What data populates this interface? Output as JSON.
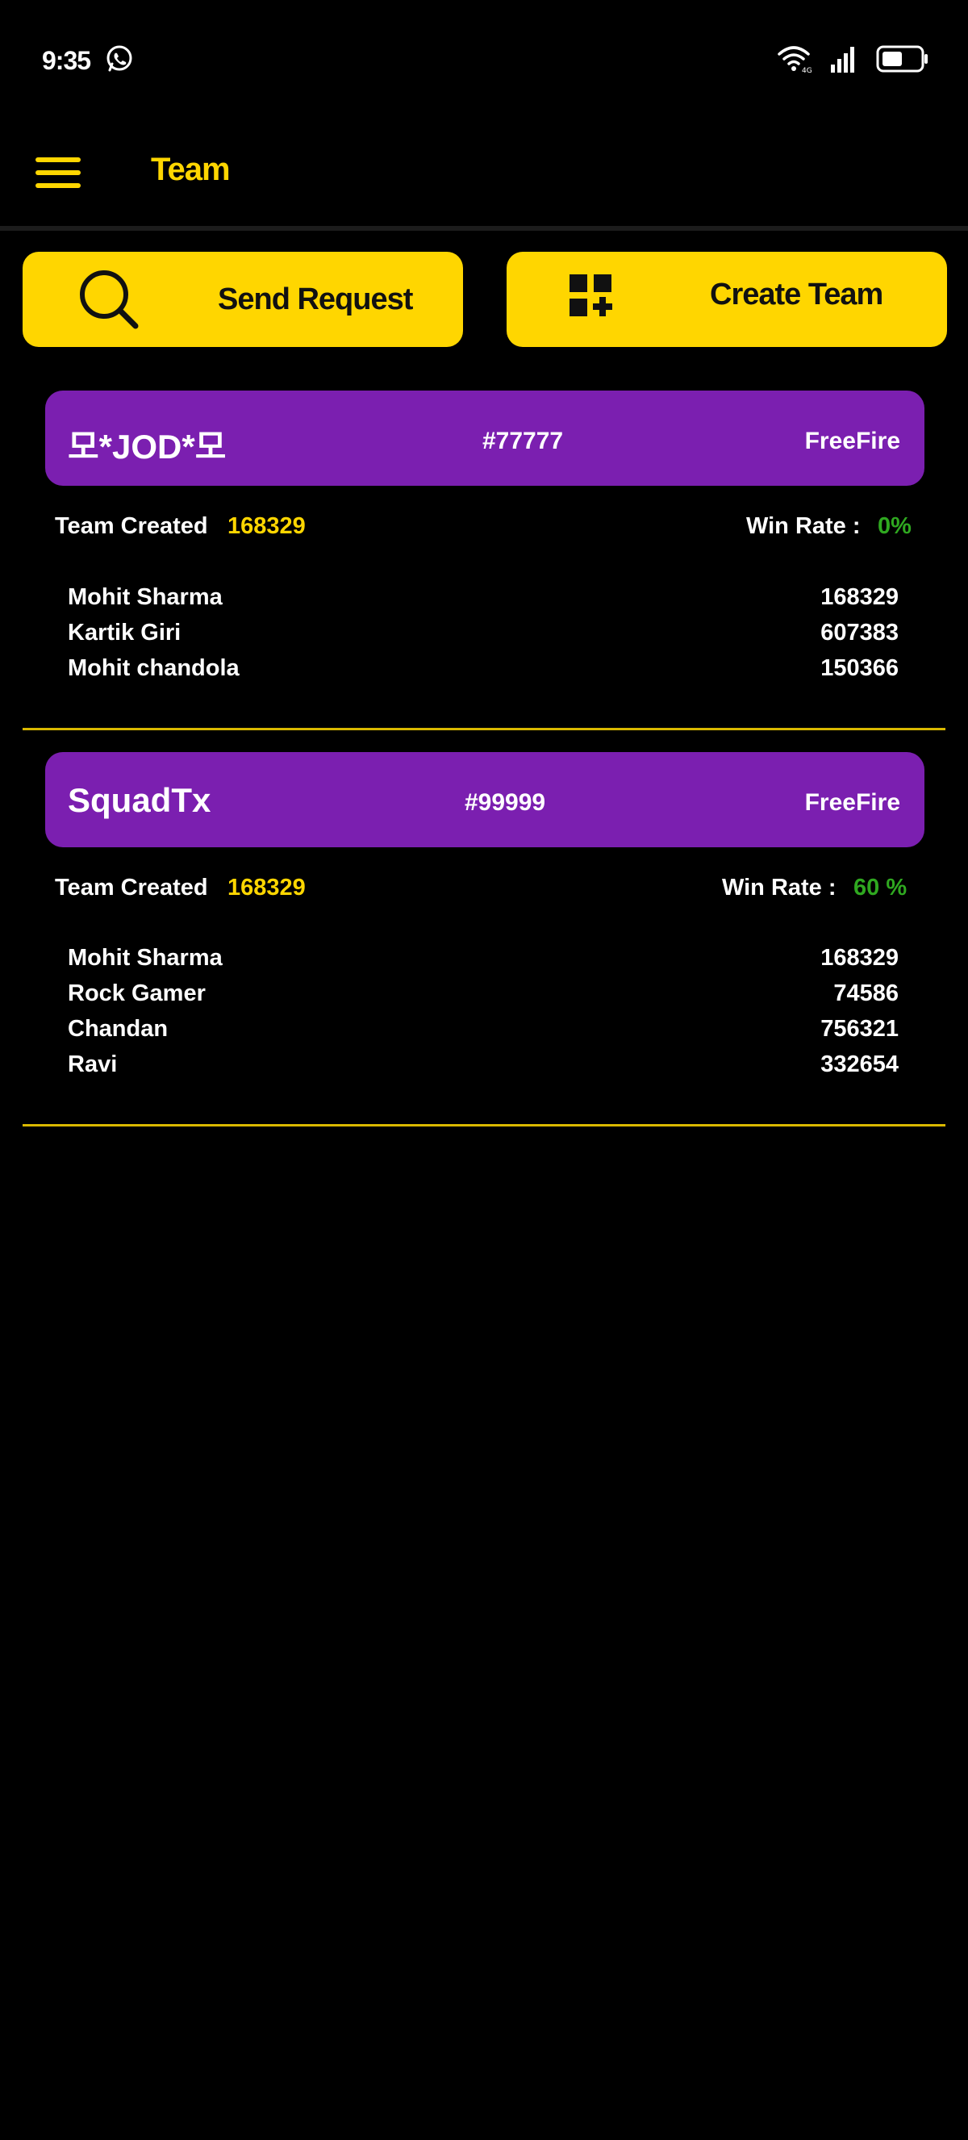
{
  "status_bar": {
    "time": "9:35"
  },
  "app_bar": {
    "title": "Team"
  },
  "actions": {
    "send_request_label": "Send Request",
    "create_team_label": "Create Team"
  },
  "teams": [
    {
      "name": "모*JOD*모",
      "code": "#77777",
      "game": "FreeFire",
      "created_label": "Team Created",
      "created_value": "168329",
      "win_rate_label": "Win Rate :",
      "win_rate_value": "0%",
      "members": [
        {
          "name": "Mohit Sharma",
          "id": "168329"
        },
        {
          "name": "Kartik Giri",
          "id": "607383"
        },
        {
          "name": "Mohit chandola",
          "id": "150366"
        }
      ]
    },
    {
      "name": "SquadTx",
      "code": "#99999",
      "game": "FreeFire",
      "created_label": "Team Created",
      "created_value": "168329",
      "win_rate_label": "Win Rate :",
      "win_rate_value": "60 %",
      "members": [
        {
          "name": "Mohit Sharma",
          "id": "168329"
        },
        {
          "name": "Rock Gamer",
          "id": "74586"
        },
        {
          "name": "Chandan",
          "id": "756321"
        },
        {
          "name": "Ravi",
          "id": "332654"
        }
      ]
    }
  ],
  "colors": {
    "accent": "#ffd600",
    "card": "#7b1fb0",
    "win_rate": "#2fa820",
    "background": "#000000"
  },
  "icons": {
    "menu": "hamburger-menu-icon",
    "search": "search-icon",
    "create": "grid-add-icon",
    "whatsapp": "whatsapp-icon",
    "wifi": "wifi-icon",
    "signal": "signal-icon",
    "battery": "battery-icon"
  }
}
